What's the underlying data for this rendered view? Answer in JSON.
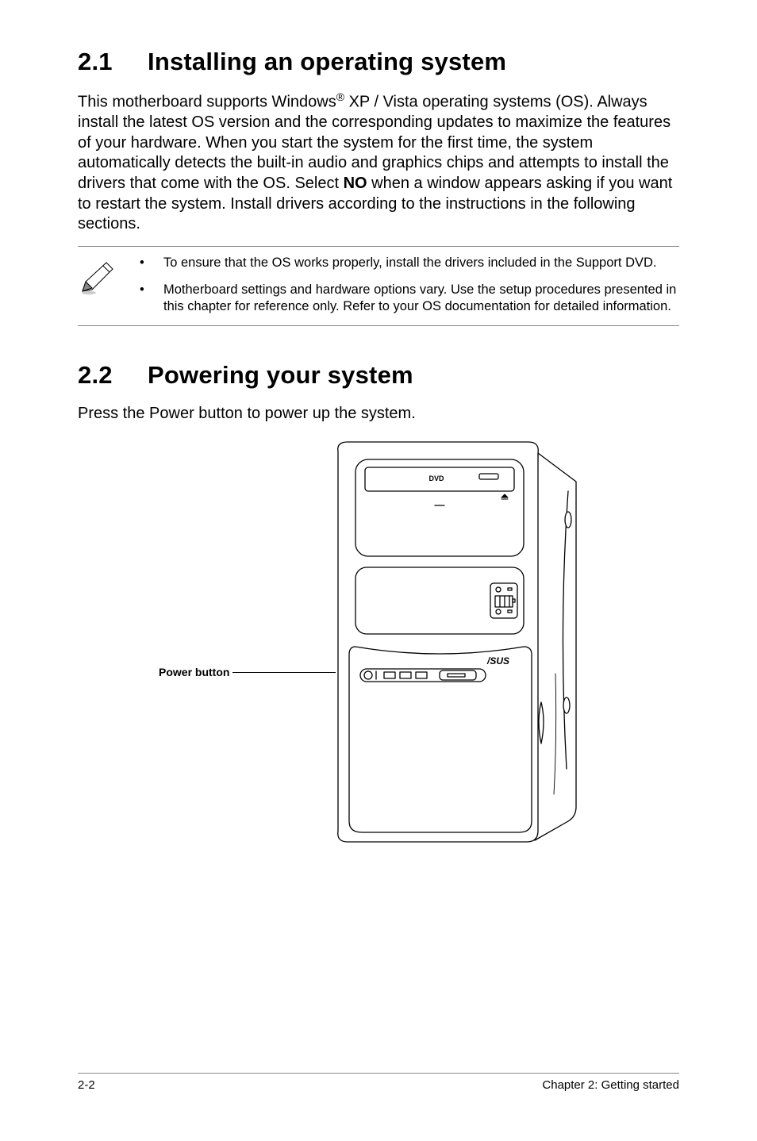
{
  "section1": {
    "number": "2.1",
    "title": "Installing an operating system",
    "body_pre_reg": "This motherboard supports Windows",
    "reg": "®",
    "body_post_reg": " XP / Vista operating systems (OS). Always install the latest OS version and the corresponding updates to maximize the features of your hardware. When you start the system for the first time, the system automatically detects the built-in audio and graphics chips and attempts to install the drivers that come with the OS. Select ",
    "bold_no": "NO",
    "body_tail": " when a window appears asking if you want to restart the system. Install drivers according to the instructions in the following sections."
  },
  "notes": {
    "bullet": "•",
    "items": [
      "To ensure that the OS works properly, install the drivers included in the Support DVD.",
      "Motherboard settings and hardware options vary. Use the setup procedures presented in this chapter for reference only. Refer to your OS documentation for detailed information."
    ]
  },
  "section2": {
    "number": "2.2",
    "title": "Powering your system",
    "body": "Press the Power button to power up the system."
  },
  "diagram": {
    "power_button_label": "Power button",
    "dvd_text": "DVD",
    "brand_text": "/SUS"
  },
  "footer": {
    "left": "2-2",
    "right": "Chapter 2: Getting started"
  }
}
